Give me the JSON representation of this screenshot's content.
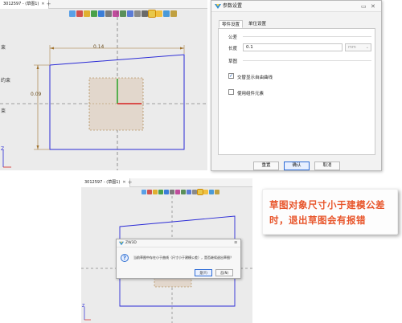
{
  "top_sketch": {
    "tab_title": "3012597 - (草图1)",
    "tab_close": "✕",
    "tab_add": "+",
    "side_labels": [
      "束",
      "约束",
      "束"
    ],
    "dim_width": "0.14",
    "dim_height": "0.09",
    "axis_letter": "Z"
  },
  "settings_dialog": {
    "title": "参数设置",
    "tabs": [
      "零件设置",
      "单位设置"
    ],
    "group_tolerance": "公差",
    "length_label": "长度",
    "length_value": "0.1",
    "length_unit": "mm",
    "group_sketch": "草图",
    "checkbox_curve": "交替显示自由曲线",
    "checkbox_constraint": "使用组件元素",
    "buttons": [
      "重置",
      "确认",
      "取消"
    ]
  },
  "bottom_sketch": {
    "tab_title": "3012597 - (草图1)",
    "tab_close": "✕",
    "tab_add": "+",
    "axis_letter": "Z"
  },
  "warning_dialog": {
    "title": "ZW3D",
    "message": "当前草图中存在小于曲线（尺寸小于建模公差），是否继续退出草图？",
    "buttons": [
      "是(Y)",
      "否(N)"
    ]
  },
  "annotation": {
    "text": "草图对象尺寸小于建模公差时，退出草图会有报错"
  },
  "colors": {
    "sketch_line": "#2a2ad6",
    "dim_line": "#a0722d",
    "axis_green": "#1aa01a",
    "axis_red": "#d62020",
    "annotation": "#e8562c",
    "primary_border": "#2d6bd6"
  }
}
